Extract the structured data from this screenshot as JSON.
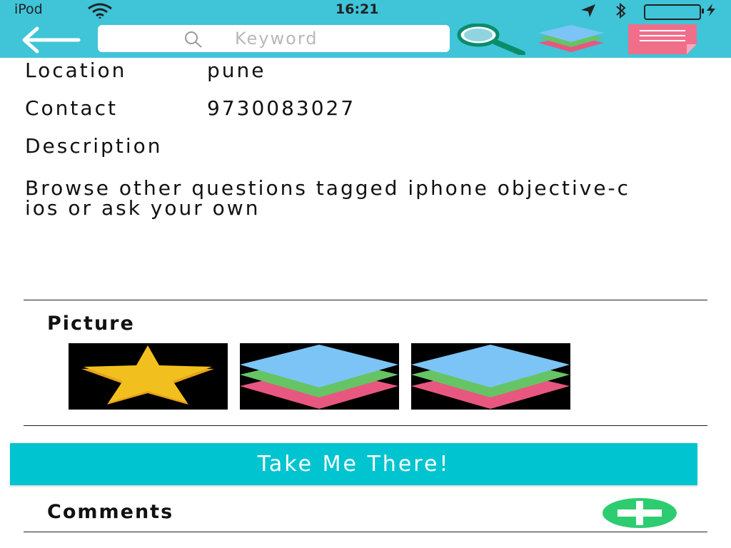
{
  "status_bar": {
    "carrier": "iPod",
    "time": "16:21",
    "icons": [
      "wifi-icon",
      "location-arrow-icon",
      "bluetooth-icon",
      "battery-icon",
      "charging-bolt-icon"
    ]
  },
  "nav": {
    "back_icon": "back-arrow-icon",
    "search_placeholder": "Keyword",
    "search_icon": "magnifier-icon",
    "layers_icon": "layers-icon",
    "notes_icon": "notes-icon"
  },
  "details": {
    "location_label": "Location",
    "location_value": "pune",
    "contact_label": "Contact",
    "contact_value": "9730083027",
    "description_label": "Description",
    "description_text": "Browse other questions tagged iphone objective-c ios or ask your own"
  },
  "pictures": {
    "title": "Picture",
    "thumbnails": [
      "star-thumbnail",
      "layers-thumbnail",
      "layers-thumbnail"
    ]
  },
  "cta": {
    "label": "Take Me There!"
  },
  "comments": {
    "title": "Comments",
    "add_icon": "plus-icon"
  },
  "colors": {
    "header": "#3fc4d8",
    "cta": "#00c4d0",
    "add_button": "#2ecc71",
    "star": "#f2c01e",
    "layer_blue": "#7cc4f5",
    "layer_green": "#66c464",
    "layer_pink": "#e8577f",
    "notes_pink": "#f06e8a"
  }
}
